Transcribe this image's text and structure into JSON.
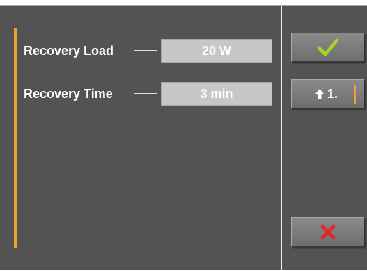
{
  "settings": {
    "rows": [
      {
        "label": "Recovery Load",
        "value": "20 W"
      },
      {
        "label": "Recovery Time",
        "value": "3 min"
      }
    ]
  },
  "side_buttons": {
    "confirm_icon": "checkmark-icon",
    "page_icon": "arrow-up-icon",
    "page_label": "1.",
    "cancel_icon": "cross-icon"
  },
  "colors": {
    "background": "#535353",
    "accent": "#f0a030",
    "confirm": "#a6d22a",
    "cancel": "#e02828",
    "value_box": "#c7c7c7"
  }
}
